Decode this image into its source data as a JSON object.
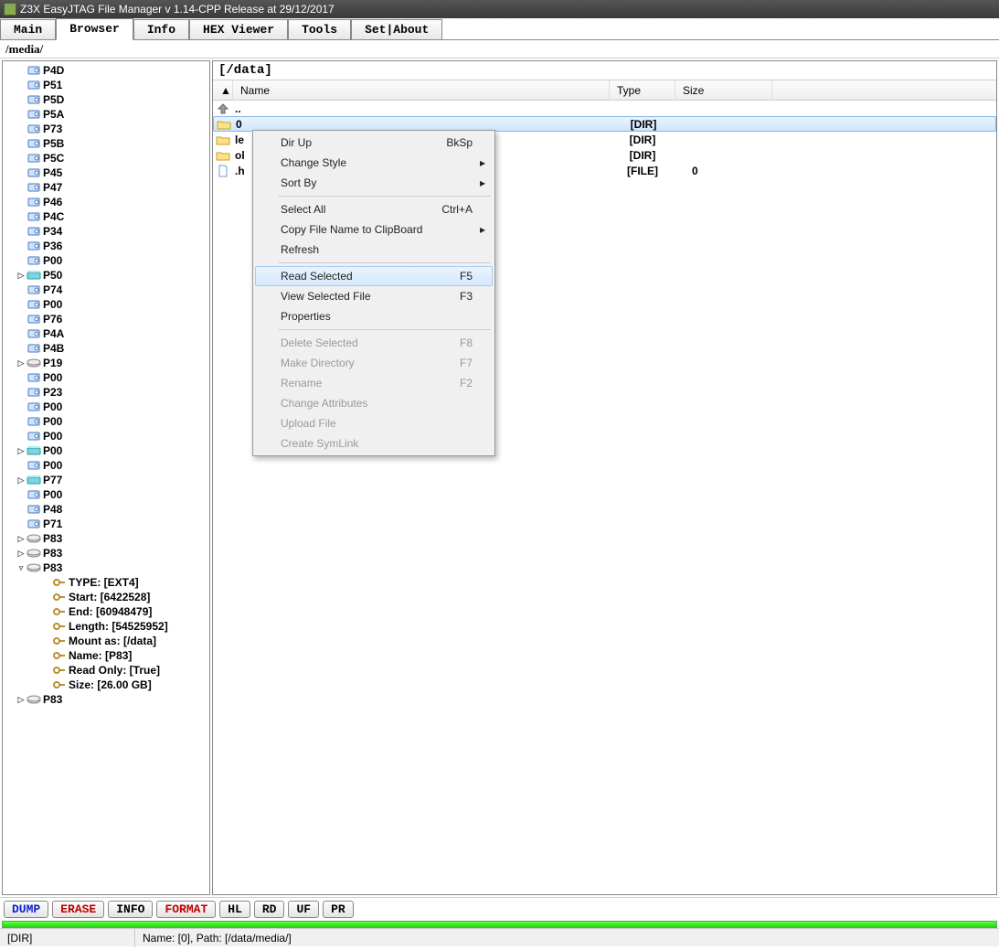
{
  "window": {
    "title": "Z3X EasyJTAG File Manager v 1.14-CPP Release at 29/12/2017"
  },
  "tabs": [
    "Main",
    "Browser",
    "Info",
    "HEX Viewer",
    "Tools",
    "Set|About"
  ],
  "active_tab": 1,
  "path_bar": "/media/",
  "tree": {
    "partitions": [
      {
        "l": "P4D",
        "i": "p"
      },
      {
        "l": "P51",
        "i": "p"
      },
      {
        "l": "P5D",
        "i": "p"
      },
      {
        "l": "P5A",
        "i": "p"
      },
      {
        "l": "P73",
        "i": "p"
      },
      {
        "l": "P5B",
        "i": "p"
      },
      {
        "l": "P5C",
        "i": "p"
      },
      {
        "l": "P45",
        "i": "p"
      },
      {
        "l": "P47",
        "i": "p"
      },
      {
        "l": "P46",
        "i": "p"
      },
      {
        "l": "P4C",
        "i": "p"
      },
      {
        "l": "P34",
        "i": "p"
      },
      {
        "l": "P36",
        "i": "p"
      },
      {
        "l": "P00",
        "i": "p"
      },
      {
        "l": "P50",
        "i": "d",
        "tw": "▷"
      },
      {
        "l": "P74",
        "i": "p"
      },
      {
        "l": "P00",
        "i": "p"
      },
      {
        "l": "P76",
        "i": "p"
      },
      {
        "l": "P4A",
        "i": "p"
      },
      {
        "l": "P4B",
        "i": "p"
      },
      {
        "l": "P19",
        "i": "g",
        "tw": "▷"
      },
      {
        "l": "P00",
        "i": "p"
      },
      {
        "l": "P23",
        "i": "p"
      },
      {
        "l": "P00",
        "i": "p"
      },
      {
        "l": "P00",
        "i": "p"
      },
      {
        "l": "P00",
        "i": "p"
      },
      {
        "l": "P00",
        "i": "d",
        "tw": "▷"
      },
      {
        "l": "P00",
        "i": "p"
      },
      {
        "l": "P77",
        "i": "d",
        "tw": "▷"
      },
      {
        "l": "P00",
        "i": "p"
      },
      {
        "l": "P48",
        "i": "p"
      },
      {
        "l": "P71",
        "i": "p"
      },
      {
        "l": "P83",
        "i": "g",
        "tw": "▷"
      },
      {
        "l": "P83",
        "i": "g",
        "tw": "▷"
      },
      {
        "l": "P83",
        "i": "g",
        "tw": "▿",
        "exp": true
      }
    ],
    "p83_details": [
      "TYPE: [EXT4]",
      "Start: [6422528]",
      "End: [60948479]",
      "Length:  [54525952]",
      "Mount as:  [/data]",
      "Name:  [P83]",
      "Read Only:  [True]",
      "Size:  [26.00 GB]"
    ],
    "tail": [
      {
        "l": "P83",
        "i": "g",
        "tw": "▷"
      }
    ]
  },
  "file_panel": {
    "crumb": "[/data]",
    "cols": {
      "name": "Name",
      "type": "Type",
      "size": "Size"
    },
    "rows": [
      {
        "icon": "up",
        "name": "..",
        "type": "",
        "size": "",
        "sel": false
      },
      {
        "icon": "folder",
        "name": "0",
        "type": "[DIR]",
        "size": "",
        "sel": true
      },
      {
        "icon": "folder",
        "name": "le",
        "type": "[DIR]",
        "size": "",
        "sel": false
      },
      {
        "icon": "folder",
        "name": "ol",
        "type": "[DIR]",
        "size": "",
        "sel": false
      },
      {
        "icon": "file",
        "name": ".h",
        "type": "[FILE]",
        "size": "0",
        "sel": false
      }
    ]
  },
  "context_menu": [
    {
      "label": "Dir Up",
      "sc": "BkSp"
    },
    {
      "label": "Change Style",
      "sub": true
    },
    {
      "label": "Sort By",
      "sub": true
    },
    {
      "sep": true
    },
    {
      "label": "Select All",
      "sc": "Ctrl+A"
    },
    {
      "label": "Copy File Name to ClipBoard",
      "sub": true
    },
    {
      "label": "Refresh"
    },
    {
      "sep": true
    },
    {
      "label": "Read Selected",
      "sc": "F5",
      "hov": true
    },
    {
      "label": "View Selected File",
      "sc": "F3"
    },
    {
      "label": "Properties"
    },
    {
      "sep": true
    },
    {
      "label": "Delete Selected",
      "sc": "F8",
      "dis": true
    },
    {
      "label": "Make Directory",
      "sc": "F7",
      "dis": true
    },
    {
      "label": "Rename",
      "sc": "F2",
      "dis": true
    },
    {
      "label": "Change Attributes",
      "dis": true
    },
    {
      "label": "Upload File",
      "dis": true
    },
    {
      "label": "Create SymLink",
      "dis": true
    }
  ],
  "bottom_buttons": [
    {
      "t": "DUMP",
      "c": "blue"
    },
    {
      "t": "ERASE",
      "c": "red"
    },
    {
      "t": "INFO",
      "c": ""
    },
    {
      "t": "FORMAT",
      "c": "red"
    },
    {
      "t": "HL",
      "c": ""
    },
    {
      "t": "RD",
      "c": ""
    },
    {
      "t": "UF",
      "c": ""
    },
    {
      "t": "PR",
      "c": ""
    }
  ],
  "status": {
    "left": "[DIR]",
    "right": "Name: [0], Path: [/data/media/]"
  }
}
